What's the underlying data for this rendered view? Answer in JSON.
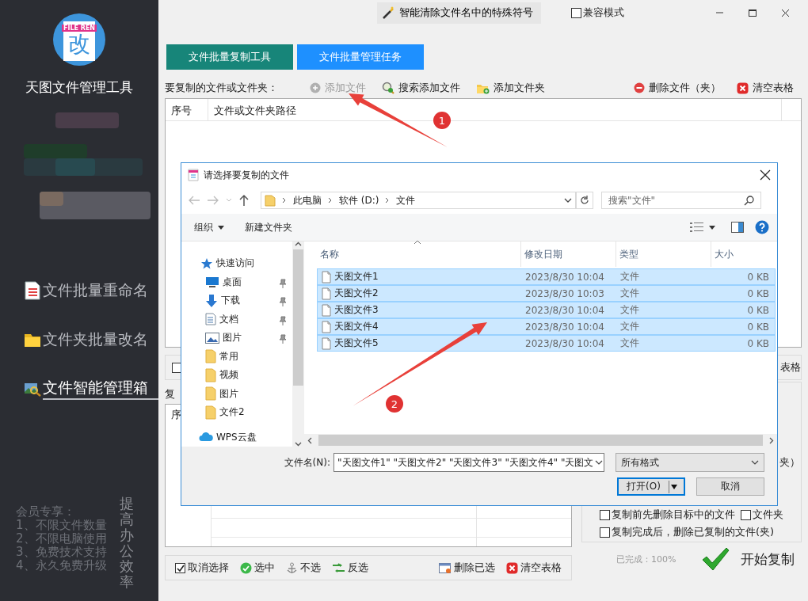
{
  "sidebar": {
    "logo": {
      "band": "FILE REN",
      "glyph": "改"
    },
    "app_name": "天图文件管理工具",
    "nav": [
      {
        "label": "文件批量重命名",
        "selected": false
      },
      {
        "label": "文件夹批量改名",
        "selected": false
      },
      {
        "label": "文件智能管理箱",
        "selected": true
      }
    ],
    "promo": {
      "title": "会员专享：",
      "lines": [
        "1、不限文件数量",
        "2、不限电脑使用",
        "3、免费技术支持",
        "4、永久免费升级"
      ],
      "slogan": "提高办公效率"
    }
  },
  "title_bar": {
    "tool_button": "智能清除文件名中的特殊符号",
    "compat_mode": {
      "label": "兼容模式",
      "checked": false
    }
  },
  "tabs": [
    {
      "label": "文件批量复制工具",
      "selected": true
    },
    {
      "label": "文件批量管理任务",
      "selected": false
    }
  ],
  "toolbar": {
    "label": "要复制的文件或文件夹：",
    "buttons": [
      {
        "kind": "add",
        "label": "添加文件",
        "disabled": true
      },
      {
        "kind": "search",
        "label": "搜索添加文件",
        "disabled": false
      },
      {
        "kind": "add-folder",
        "label": "添加文件夹",
        "disabled": false
      },
      {
        "kind": "delete",
        "label": "删除文件（夹）",
        "disabled": false
      },
      {
        "kind": "clear",
        "label": "清空表格",
        "disabled": false
      }
    ]
  },
  "source_table": {
    "columns": [
      "序号",
      "文件或文件夹路径"
    ]
  },
  "options_row": {
    "checked": false,
    "right_text": "表格"
  },
  "target": {
    "label": "复",
    "columns": [
      "序"
    ]
  },
  "right_panel": {
    "options": [
      {
        "kind": "text",
        "label": "夹）"
      },
      {
        "kind": "checkbox-pair",
        "label": "复制前先删除目标中的文件",
        "checked": false,
        "second_label": "文件夹",
        "second_checked": false
      },
      {
        "kind": "checkbox",
        "label": "复制完成后，删除已复制的文件(夹)",
        "checked": false
      }
    ]
  },
  "progress": {
    "label": "已完成：100%"
  },
  "start_button": "开始复制",
  "bottom_bar": [
    {
      "kind": "checkbox",
      "label": "取消选择",
      "checked": true
    },
    {
      "kind": "select",
      "label": "选中"
    },
    {
      "kind": "deselect",
      "label": "不选"
    },
    {
      "kind": "invert",
      "label": "反选"
    },
    {
      "kind": "delete-selected",
      "label": "删除已选"
    },
    {
      "kind": "clear",
      "label": "清空表格"
    }
  ],
  "dialog": {
    "title": "请选择要复制的文件",
    "path": [
      "此电脑",
      "软件 (D:)",
      "文件"
    ],
    "search_placeholder": "搜索\"文件\"",
    "commands": [
      {
        "label": "组织",
        "dropdown": true
      },
      {
        "label": "新建文件夹",
        "dropdown": false
      }
    ],
    "nav": [
      {
        "label": "快速访问",
        "kind": "star",
        "children": [
          {
            "label": "桌面",
            "kind": "desktop",
            "pinned": true
          },
          {
            "label": "下载",
            "kind": "download",
            "pinned": true
          },
          {
            "label": "文档",
            "kind": "document",
            "pinned": true
          },
          {
            "label": "图片",
            "kind": "image",
            "pinned": true
          },
          {
            "label": "常用",
            "kind": "folder",
            "pinned": false
          },
          {
            "label": "视频",
            "kind": "folder",
            "pinned": false
          },
          {
            "label": "图片",
            "kind": "folder",
            "pinned": false
          },
          {
            "label": "文件2",
            "kind": "folder",
            "pinned": false
          }
        ]
      },
      {
        "label": "WPS云盘",
        "kind": "cloud"
      }
    ],
    "columns": [
      "名称",
      "修改日期",
      "类型",
      "大小"
    ],
    "files": [
      {
        "name": "天图文件1",
        "modified": "2023/8/30 10:04",
        "type": "文件",
        "size": "0 KB",
        "selected": true
      },
      {
        "name": "天图文件2",
        "modified": "2023/8/30 10:03",
        "type": "文件",
        "size": "0 KB",
        "selected": true
      },
      {
        "name": "天图文件3",
        "modified": "2023/8/30 10:04",
        "type": "文件",
        "size": "0 KB",
        "selected": true
      },
      {
        "name": "天图文件4",
        "modified": "2023/8/30 10:04",
        "type": "文件",
        "size": "0 KB",
        "selected": true
      },
      {
        "name": "天图文件5",
        "modified": "2023/8/30 10:04",
        "type": "文件",
        "size": "0 KB",
        "selected": true
      }
    ],
    "file_name_label": "文件名(N):",
    "file_name": "\"天图文件1\" \"天图文件2\" \"天图文件3\" \"天图文件4\" \"天图文",
    "filter": "所有格式",
    "buttons": [
      {
        "kind": "open",
        "label": "打开(O)"
      },
      {
        "kind": "cancel",
        "label": "取消"
      }
    ]
  },
  "annotations": [
    {
      "label": "1"
    },
    {
      "label": "2"
    }
  ]
}
